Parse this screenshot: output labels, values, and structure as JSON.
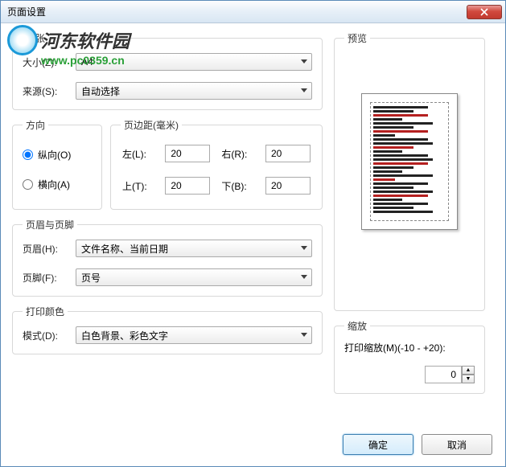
{
  "window": {
    "title": "页面设置"
  },
  "watermark": {
    "brand": "河东软件园",
    "url": "www.pc0359.cn"
  },
  "paper": {
    "legend": "纸张",
    "size_label": "大小(Z):",
    "size_value": "A4",
    "source_label": "来源(S):",
    "source_value": "自动选择"
  },
  "orientation": {
    "legend": "方向",
    "portrait": "纵向(O)",
    "landscape": "横向(A)",
    "value": "portrait"
  },
  "margins": {
    "legend": "页边距(毫米)",
    "left_label": "左(L):",
    "left": "20",
    "right_label": "右(R):",
    "right": "20",
    "top_label": "上(T):",
    "top": "20",
    "bottom_label": "下(B):",
    "bottom": "20"
  },
  "headerfooter": {
    "legend": "页眉与页脚",
    "header_label": "页眉(H):",
    "header_value": "文件名称、当前日期",
    "footer_label": "页脚(F):",
    "footer_value": "页号"
  },
  "printcolor": {
    "legend": "打印颜色",
    "mode_label": "模式(D):",
    "mode_value": "白色背景、彩色文字"
  },
  "preview": {
    "legend": "预览"
  },
  "scale": {
    "legend": "缩放",
    "label": "打印缩放(M)(-10 - +20):",
    "value": "0"
  },
  "buttons": {
    "ok": "确定",
    "cancel": "取消"
  }
}
